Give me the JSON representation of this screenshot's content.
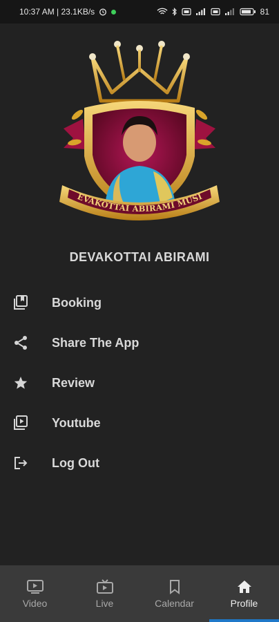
{
  "status_bar": {
    "time": "10:37 AM | 23.1KB/s",
    "battery": "81"
  },
  "logo": {
    "banner_text": "DEVAKOTTAI ABIRAMI MUSIC"
  },
  "profile": {
    "name": "DEVAKOTTAI ABIRAMI"
  },
  "menu": [
    {
      "label": "Booking",
      "icon": "booking-icon"
    },
    {
      "label": "Share The App",
      "icon": "share-icon"
    },
    {
      "label": "Review",
      "icon": "star-icon"
    },
    {
      "label": "Youtube",
      "icon": "youtube-icon"
    },
    {
      "label": "Log Out",
      "icon": "logout-icon"
    }
  ],
  "bottom_nav": [
    {
      "label": "Video",
      "icon": "video-icon"
    },
    {
      "label": "Live",
      "icon": "live-tv-icon"
    },
    {
      "label": "Calendar",
      "icon": "bookmark-icon"
    },
    {
      "label": "Profile",
      "icon": "home-icon",
      "active": true
    }
  ],
  "colors": {
    "background": "#222222",
    "status_bar": "#161616",
    "bottom_nav": "#3a3a3a",
    "accent": "#1f78c8",
    "gold": "#d9a42a",
    "maroon": "#7a0d2e"
  }
}
